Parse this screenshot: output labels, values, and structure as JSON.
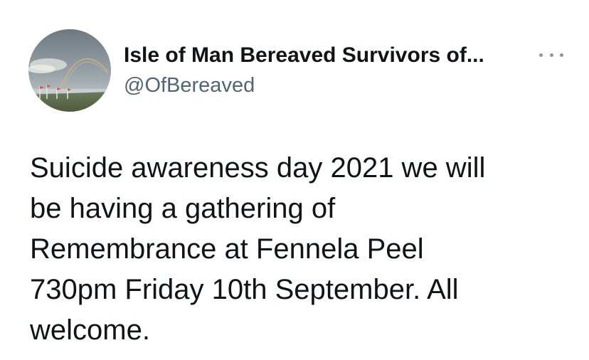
{
  "author": {
    "name": "Isle of Man Bereaved Survivors of...",
    "handle": "@OfBereaved",
    "avatar_icon": "landscape-rainbow-avatar"
  },
  "menu": {
    "icon": "more-options-icon"
  },
  "tweet": {
    "lines": [
      "Suicide awareness day 2021 we will",
      "be having a gathering of",
      "Remembrance at Fennela Peel",
      "730pm Friday 10th September. All",
      "welcome."
    ]
  },
  "colors": {
    "text": "#0f1419",
    "secondary_text": "#536471",
    "background": "#ffffff"
  }
}
